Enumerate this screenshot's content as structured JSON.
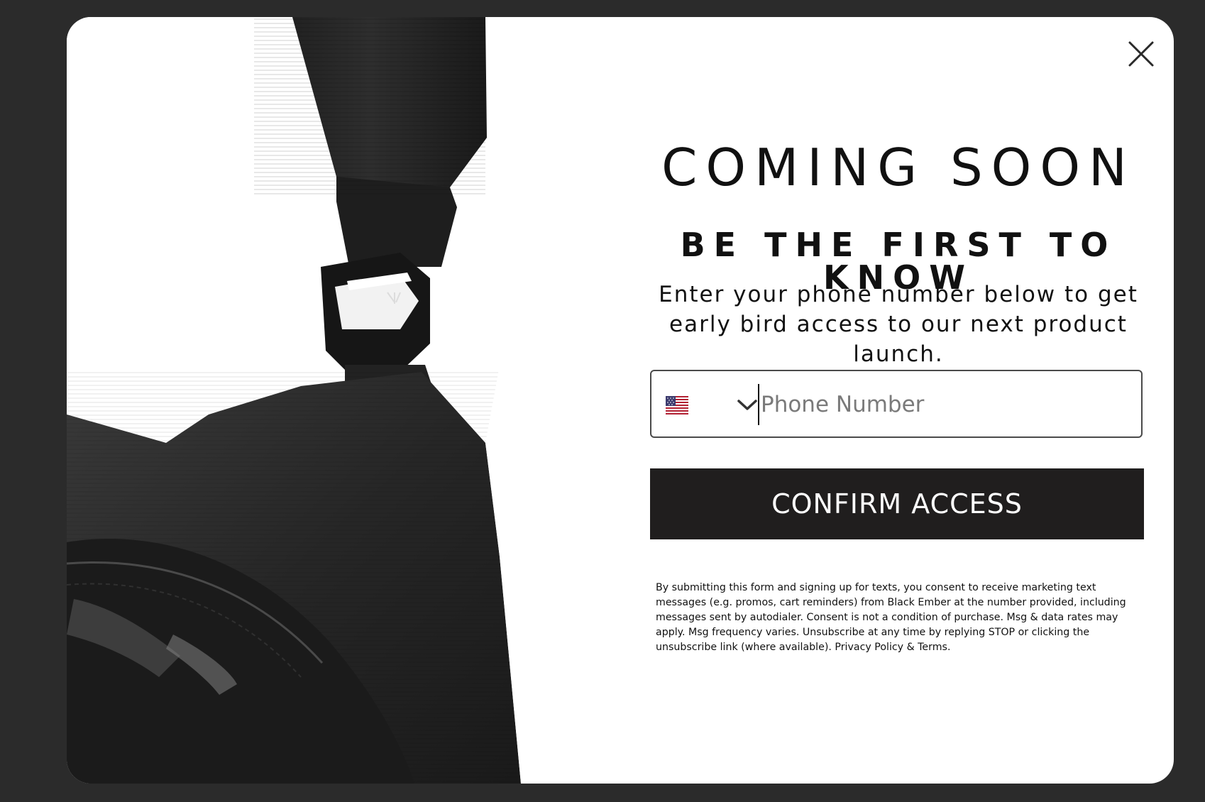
{
  "modal": {
    "title": "COMING SOON",
    "subtitle": "BE THE FIRST TO KNOW",
    "description": "Enter your phone number below to get early bird access to our next product launch.",
    "phone": {
      "country_flag_icon": "us-flag-icon",
      "dropdown_icon": "chevron-down-icon",
      "placeholder": "Phone Number",
      "value": ""
    },
    "confirm_label": "CONFIRM ACCESS",
    "legal_text": "By submitting this form and signing up for texts, you consent to receive marketing text messages (e.g. promos, cart reminders) from Black Ember at the number provided, including messages sent by autodialer. Consent is not a condition of purchase. Msg & data rates may apply. Msg frequency varies. Unsubscribe at any time by replying STOP or clicking the unsubscribe link (where available). Privacy Policy & Terms.",
    "close_icon": "close-icon"
  },
  "colors": {
    "backdrop": "#2b2b2b",
    "modal_bg": "#ffffff",
    "button_bg": "#201e1e",
    "button_text": "#ffffff",
    "text": "#111111"
  }
}
